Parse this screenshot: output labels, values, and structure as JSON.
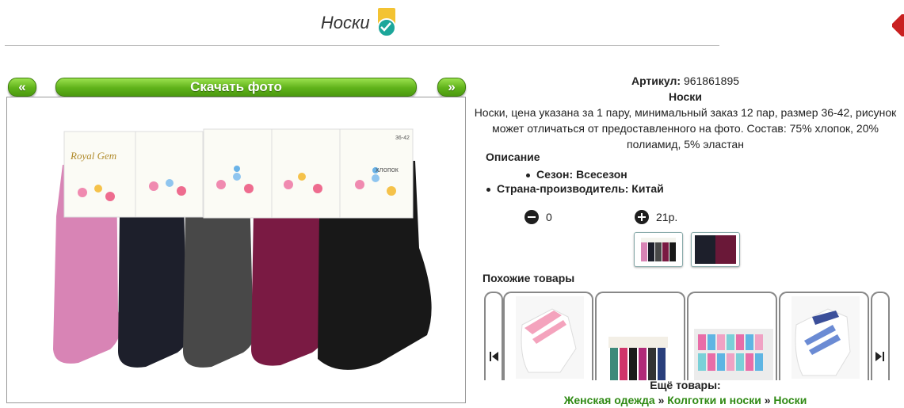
{
  "page": {
    "title": "Носки"
  },
  "gallery": {
    "prev_label": "«",
    "next_label": "»",
    "download_label": "Скачать фото",
    "packaging_brand": "Royal Gem",
    "packaging_word": "хлопок",
    "packaging_size": "36-42",
    "sock_colors": [
      "#d97fb4",
      "#1d1f2b",
      "#4a4a4a",
      "#7c1a44",
      "#1a1a1a"
    ]
  },
  "product": {
    "article_label": "Артикул:",
    "article_value": "961861895",
    "name": "Носки",
    "description": "Носки, цена указана за 1 пару, минимальный заказ 12 пар, размер 36-42, рисунок может отличаться от предоставленного на фото. Состав: 75% хлопок, 20% полиамид, 5% эластан",
    "desc_heading": "Описание",
    "props": [
      {
        "text": "Сезон: Всесезон"
      },
      {
        "text": "Страна-производитель: Китай"
      }
    ]
  },
  "order": {
    "quantity": "0",
    "price": "21р."
  },
  "similar": {
    "heading": "Похожие товары"
  },
  "more": {
    "title": "Ещё товары:",
    "crumbs": [
      {
        "label": "Женская одежда"
      },
      {
        "label": "Колготки и носки"
      },
      {
        "label": "Носки"
      }
    ],
    "separator": "»"
  }
}
